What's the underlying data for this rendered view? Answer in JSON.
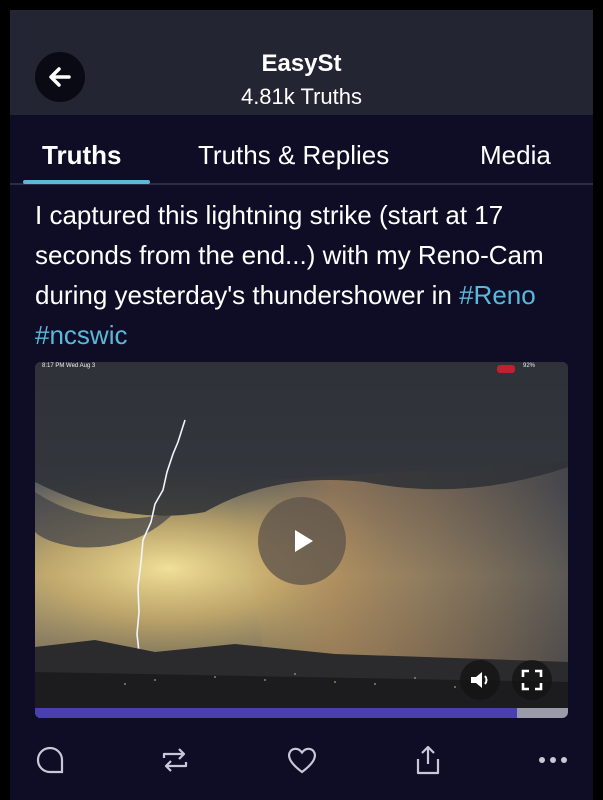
{
  "header": {
    "title": "EasySt",
    "subtitle": "4.81k Truths"
  },
  "tabs": [
    {
      "label": "Truths",
      "active": true
    },
    {
      "label": "Truths & Replies",
      "active": false
    },
    {
      "label": "Media",
      "active": false
    }
  ],
  "post": {
    "text": "I captured this lightning strike (start at 17 seconds from the end...) with my Reno-Cam during yesterday's thundershower in ",
    "hashtags": [
      "#Reno",
      "#ncswic"
    ]
  },
  "video": {
    "status_time": "8:17 PM  Wed Aug 3",
    "status_battery": "92%",
    "progress": 0.905
  },
  "actions": [
    {
      "name": "reply-icon"
    },
    {
      "name": "retruth-icon"
    },
    {
      "name": "like-icon"
    },
    {
      "name": "share-icon"
    },
    {
      "name": "more-icon"
    }
  ],
  "colors": {
    "accent": "#5ab8d8",
    "background": "#0f0d26",
    "header": "#232533",
    "progress": "#4a3fb0"
  }
}
